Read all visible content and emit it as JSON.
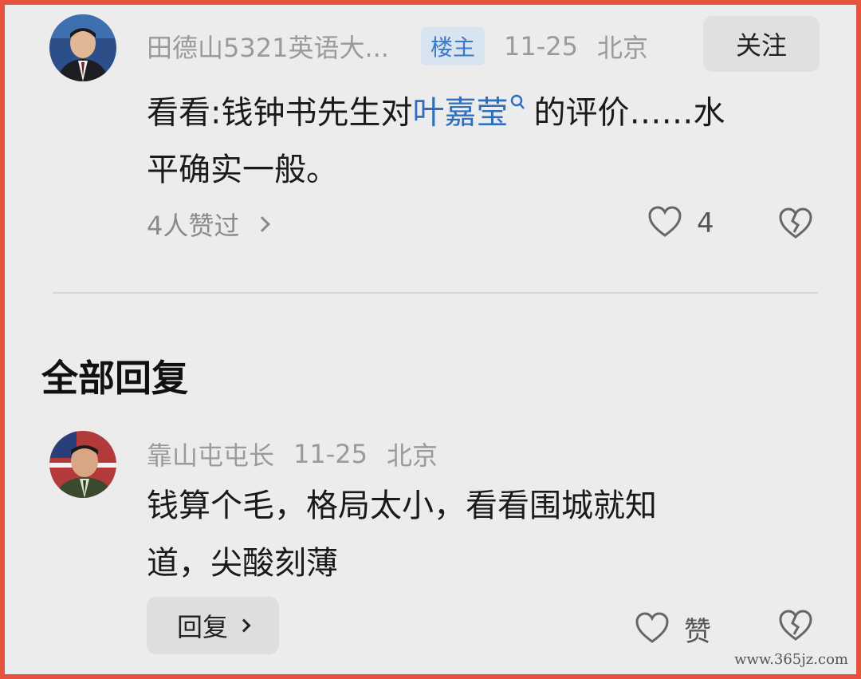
{
  "post": {
    "author": "田德山5321英语大...",
    "badge": "楼主",
    "date": "11-25",
    "location": "北京",
    "follow_label": "关注",
    "text_before": "看看:钱钟书先生对",
    "link_text": "叶嘉莹",
    "text_after": "的评价……水",
    "text_line2": "平确实一般。",
    "likes_summary": "4人赞过",
    "like_count": "4"
  },
  "section_title": "全部回复",
  "reply": {
    "author": "靠山屯屯长",
    "date": "11-25",
    "location": "北京",
    "line1": "钱算个毛，格局太小，看看围城就知",
    "line2": "道，尖酸刻薄",
    "reply_label": "回复",
    "praise_label": "赞"
  },
  "watermark": "www.365jz.com",
  "colors": {
    "border": "#e8533f",
    "link": "#2f6fbf",
    "badge_bg": "#d9e4f1"
  },
  "icons": [
    "heart-icon",
    "broken-heart-icon",
    "search-icon",
    "chevron-right-icon"
  ]
}
